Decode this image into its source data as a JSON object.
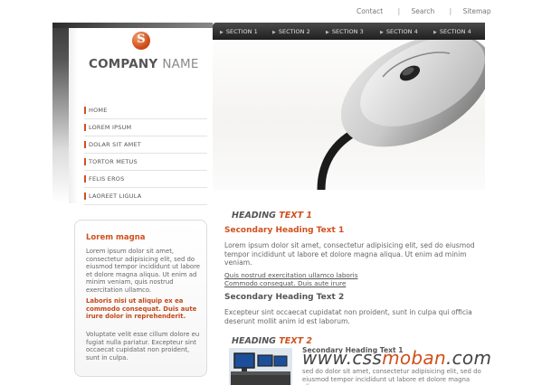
{
  "top_links": {
    "contact": "Contact",
    "search": "Search",
    "sitemap": "Sitemap",
    "sep": "|"
  },
  "logo": {
    "mark": "S",
    "company": "COMPANY",
    "name": "NAME"
  },
  "nav": [
    {
      "label": "HOME"
    },
    {
      "label": "LOREM IPSUM"
    },
    {
      "label": "DOLAR SIT AMET"
    },
    {
      "label": "TORTOR METUS"
    },
    {
      "label": "FELIS EROS"
    },
    {
      "label": "LAOREET LIGULA"
    }
  ],
  "sections": [
    {
      "label": "SECTION 1"
    },
    {
      "label": "SECTION 2"
    },
    {
      "label": "SECTION 3"
    },
    {
      "label": "SECTION 4"
    },
    {
      "label": "SECTION 4"
    }
  ],
  "heading1": {
    "part1": "HEADING",
    "part2": "TEXT 1"
  },
  "heading2": {
    "part1": "HEADING",
    "part2": "TEXT 2"
  },
  "content": {
    "sec1": "Secondary Heading Text 1",
    "para1": "Lorem ipsum dolor sit amet, consectetur adipisicing elit, sed do eiusmod tempor incididunt ut labore et dolore magna aliqua. Ut enim ad minim veniam.",
    "link1": "Quis nostrud exercitation ullamco laboris",
    "link2": "Commodo consequat. Duis aute irure",
    "sec2": "Secondary Heading Text 2",
    "para2": "Excepteur sint occaecat cupidatat non proident, sunt in culpa qui officia deserunt mollit anim id est laborum.",
    "sec3": "Secondary Heading Text 1",
    "para3": "sed do dolor sit amet, consectetur adipisicing elit, sed do eiusmod tempor incididunt ut labore et dolore magna aliqua."
  },
  "sidebar": {
    "title": "Lorem magna",
    "p1": "Lorem ipsum dolor sit amet, consectetur adipisicing elit, sed do eiusmod tempor incididunt ut labore et dolore magna aliqua. Ut enim ad minim veniam, quis nostrud exercitation ullamco.",
    "p2": "Laboris nisi ut aliquip ex ea commodo consequat. Duis aute irure dolor in reprehenderit.",
    "p3": "Voluptate velit esse cillum dolore eu fugiat nulla pariatur. Excepteur sint occaecat cupidatat non proident, sunt in culpa."
  },
  "watermark": {
    "part1": "www.css",
    "part2": "moban",
    "part3": ".com"
  },
  "colors": {
    "accent": "#d0501e",
    "text": "#555555",
    "bar": "#2b2b2b"
  }
}
